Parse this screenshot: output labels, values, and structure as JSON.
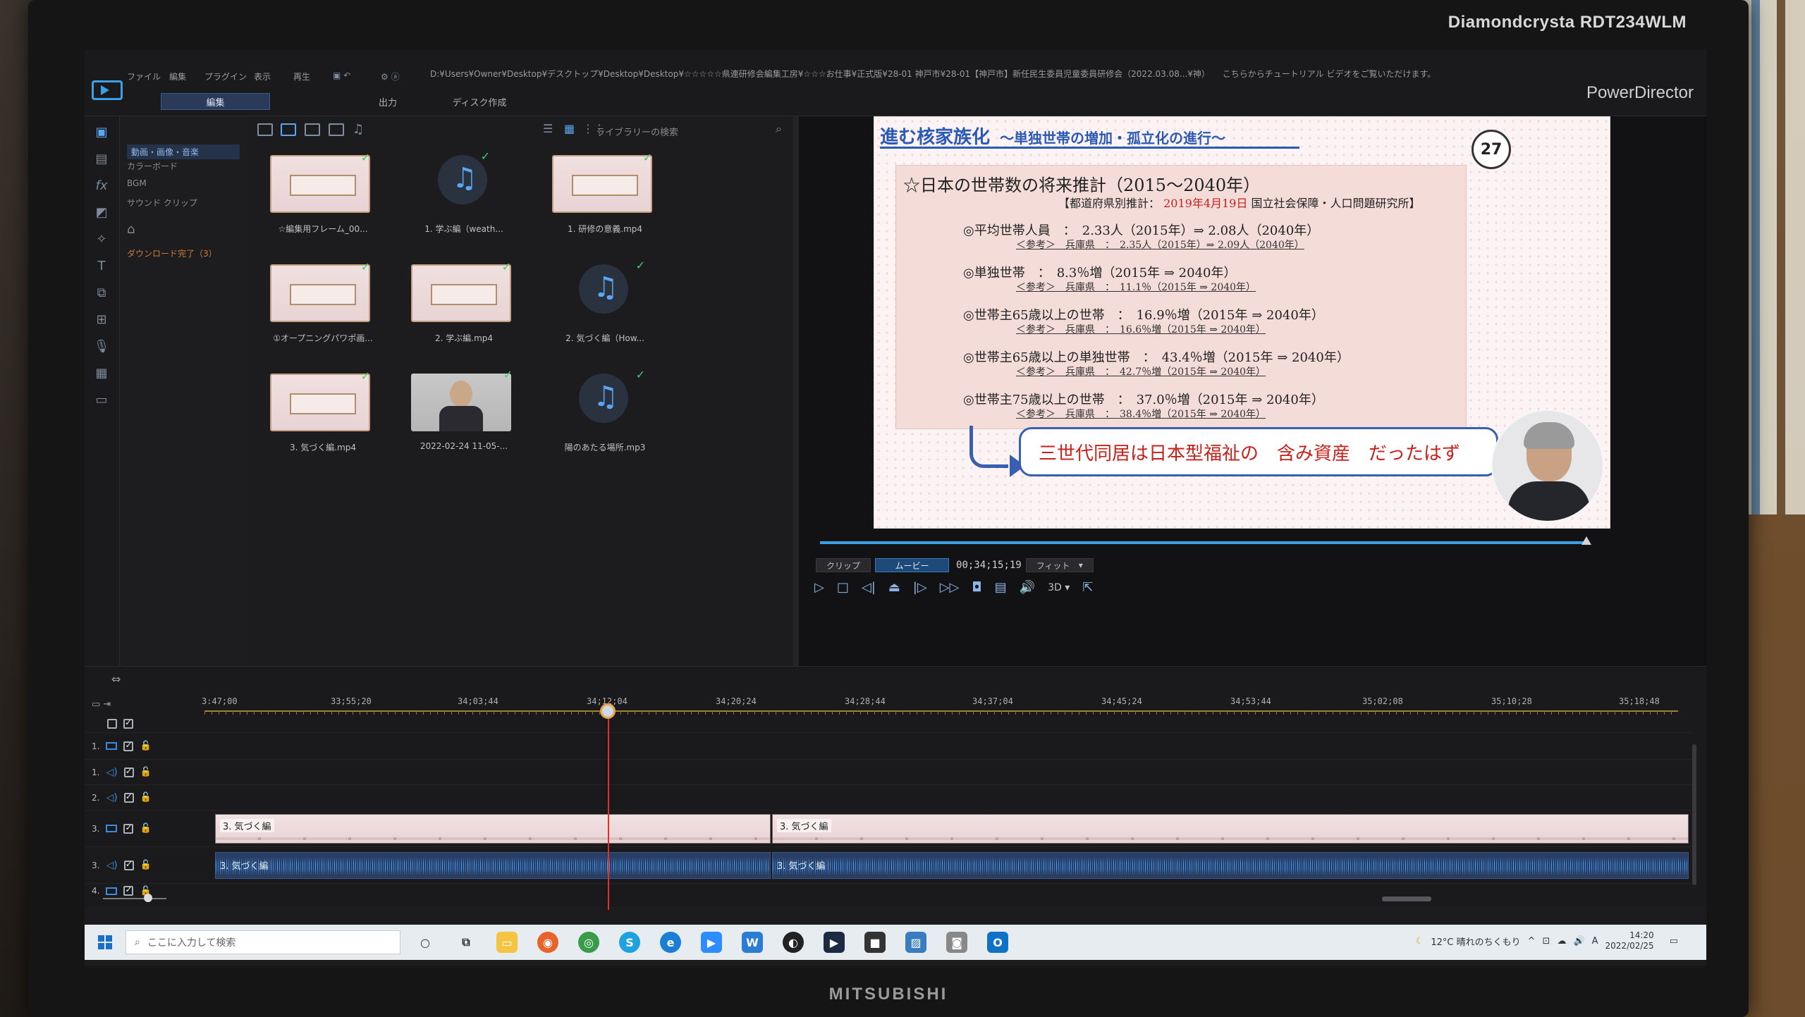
{
  "monitor": {
    "model": "Diamondcrysta RDT234WLM",
    "maker": "MITSUBISHI"
  },
  "app": {
    "name": "PowerDirector",
    "menus": [
      "ファイル",
      "編集",
      "プラグイン",
      "表示",
      "再生"
    ],
    "path": "D:¥Users¥Owner¥Desktop¥デスクトップ¥Desktop¥Desktop¥☆☆☆☆☆県連研修会編集工房¥☆☆☆お仕事¥正式版¥28-01 神戸市¥28-01【神戸市】新任民生委員児童委員研修会（2022.03.08...¥神）",
    "path_hint": "こちらからチュートリアル ビデオをご覧いただけます。",
    "modes": [
      "編集",
      "出力",
      "ディスク作成"
    ]
  },
  "categories": {
    "items": [
      "動画・画像・音楽",
      "カラーボード",
      "BGM",
      "サウンド クリップ"
    ],
    "download": "ダウンロード完了（3）"
  },
  "library": {
    "search_placeholder": "ライブラリーの検索",
    "items": [
      {
        "caption": "☆編集用フレーム_00...",
        "kind": "slide"
      },
      {
        "caption": "1. 学ぶ編（weath...",
        "kind": "audio"
      },
      {
        "caption": "1. 研修の意義.mp4",
        "kind": "slide"
      },
      {
        "caption": "①オープニングパワポ画...",
        "kind": "slide"
      },
      {
        "caption": "2. 学ぶ編.mp4",
        "kind": "slide"
      },
      {
        "caption": "2. 気づく編（How...",
        "kind": "audio"
      },
      {
        "caption": "3. 気づく編.mp4",
        "kind": "slide"
      },
      {
        "caption": "2022-02-24 11-05-...",
        "kind": "person"
      },
      {
        "caption": "陽のあたる場所.mp3",
        "kind": "audio"
      }
    ]
  },
  "slide": {
    "title": "進む核家族化",
    "subtitle": "～単独世帯の増加・孤立化の進行～",
    "number": "27",
    "projection_title": "☆日本の世帯数の将来推計（2015～2040年）",
    "source_prefix": "【都道府県別推計：",
    "source_date": "2019年4月19日",
    "source_suffix": "国立社会保障・人口問題研究所】",
    "stats": [
      {
        "main": "◎平均世帯人員　：　2.33人（2015年）⇒ 2.08人（2040年）",
        "ref": "＜参考＞　兵庫県　：　2.35人（2015年）⇒ 2.09人（2040年）"
      },
      {
        "main": "◎単独世帯　：　8.3％増（2015年 ⇒ 2040年）",
        "ref": "＜参考＞　兵庫県　：　11.1％（2015年 ⇒ 2040年）"
      },
      {
        "main": "◎世帯主65歳以上の世帯　：　16.9％増（2015年 ⇒ 2040年）",
        "ref": "＜参考＞　兵庫県　：　16.6％増（2015年 ⇒ 2040年）"
      },
      {
        "main": "◎世帯主65歳以上の単独世帯　：　43.4％増（2015年 ⇒ 2040年）",
        "ref": "＜参考＞　兵庫県　：　42.7％増（2015年 ⇒ 2040年）"
      },
      {
        "main": "◎世帯主75歳以上の世帯　：　37.0％増（2015年 ⇒ 2040年）",
        "ref": "＜参考＞　兵庫県　：　38.4％増（2015年 ⇒ 2040年）"
      }
    ],
    "callout": "三世代同居は日本型福祉の　含み資産　だったはず"
  },
  "preview": {
    "clip_label": "クリップ",
    "movie_label": "ムービー",
    "timecode": "00;34;15;19",
    "fit_label": "フィット",
    "three_d_label": "3D"
  },
  "timeline": {
    "ruler": [
      "3:47;00",
      "33;55;20",
      "34;03;44",
      "34;12;04",
      "34;20;24",
      "34;28;44",
      "34;37;04",
      "34;45;24",
      "34;53;44",
      "35;02;08",
      "35;10;28",
      "35;18;48"
    ],
    "tracks": [
      {
        "num": "1.",
        "kind": "video"
      },
      {
        "num": "1.",
        "kind": "audio"
      },
      {
        "num": "2.",
        "kind": "audio"
      },
      {
        "num": "3.",
        "kind": "video"
      },
      {
        "num": "3.",
        "kind": "audio"
      },
      {
        "num": "4.",
        "kind": "video"
      }
    ],
    "clip_label": "3. 気づく編"
  },
  "taskbar": {
    "search_placeholder": "ここに入力して検索",
    "weather": "12°C 晴れのちくもり",
    "ime": "A",
    "time": "14:20",
    "date": "2022/02/25"
  },
  "colors": {
    "accent": "#3aa0e8",
    "slide_title": "#2b59b6",
    "callout_red": "#c8201b",
    "playhead": "#e0302a"
  }
}
